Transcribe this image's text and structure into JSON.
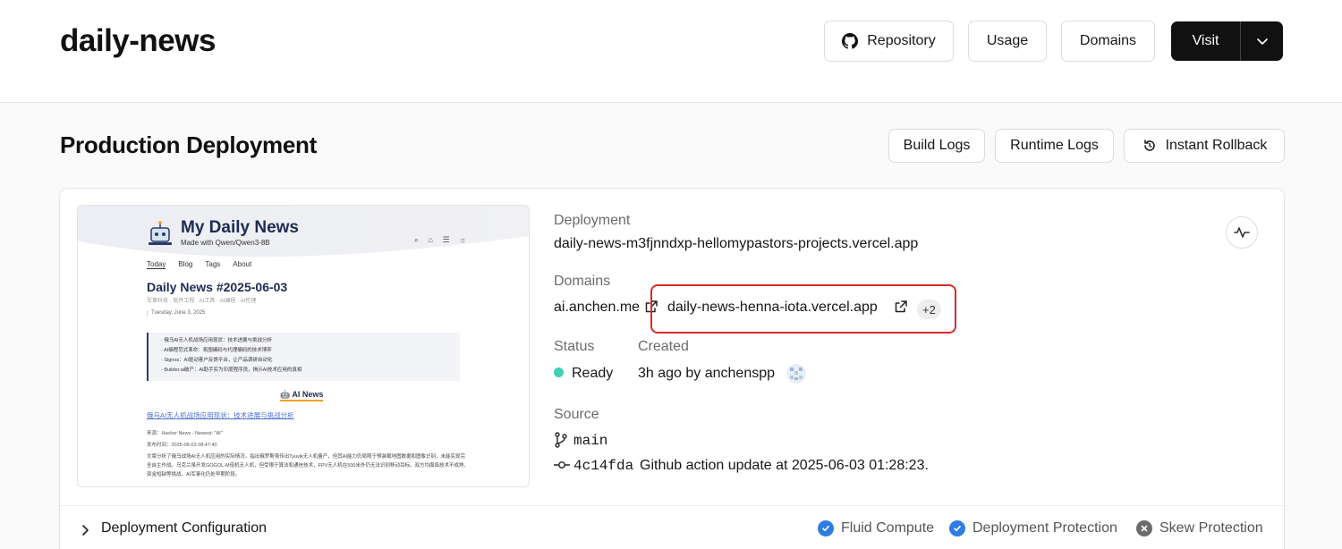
{
  "header": {
    "title": "daily-news",
    "repository_label": "Repository",
    "usage_label": "Usage",
    "domains_label": "Domains",
    "visit_label": "Visit"
  },
  "section": {
    "title": "Production Deployment",
    "build_logs_label": "Build Logs",
    "runtime_logs_label": "Runtime Logs",
    "rollback_label": "Instant Rollback"
  },
  "preview": {
    "site_title": "My Daily News",
    "site_subtitle": "Made with Qwen/Qwen3-8B",
    "nav": [
      "Today",
      "Blog",
      "Tags",
      "About"
    ],
    "post_title": "Daily News #2025-06-03",
    "post_tags": "军事科技 · 软件工程 · AI工具 · AI编程 · AI伦理",
    "post_date": "Tuesday, June 3, 2025",
    "summary_items": [
      "· 俄乌AI无人机战场应用现状：技术进展与挑战分析",
      "· AI编程范式革命：氛围编码与代理编码的技术博弈",
      "· Signos：AI驱动客户反馈平台，让产品调研自动化",
      "· Builder.ai破产：AI助手实为印度程序员，揭示AI技术应用的真相"
    ],
    "section_heading": "🤖 AI News",
    "article_link": "俄乌AI无人机战场应用现状：技术进展与挑战分析",
    "article_source": "来源：Hacker News - Newest: \"AI\"",
    "article_time": "发布时间：2025-06-03 08:47:40",
    "article_body": "文章分析了俄乌战场AI无人机应用的实际情况，指出俄罗斯虽传出Tyuvik无人机量产，但其AI能力仍局限于预装载地图数据和图像识别，未能实现完全自主作战。乌克兰虽开发GOGOL-M母机无人机，但受限于算法和通信技术，FPV无人机在500米外仍无法识别移动目标。双方均面临技术不成熟、资金短缺等挑战，AI军事化仍处早期阶段。"
  },
  "deployment": {
    "label": "Deployment",
    "url": "daily-news-m3fjnndxp-hellomypastors-projects.vercel.app"
  },
  "domains": {
    "label": "Domains",
    "primary": "ai.anchen.me",
    "secondary": "daily-news-henna-iota.vercel.app",
    "more_count": "+2"
  },
  "status": {
    "label": "Status",
    "value": "Ready",
    "color": "#3fd1b2"
  },
  "created": {
    "label": "Created",
    "value": "3h ago by anchenspp"
  },
  "source": {
    "label": "Source",
    "branch": "main",
    "commit_hash": "4c14fda",
    "commit_message": "Github action update at 2025-06-03 01:28:23."
  },
  "config": {
    "label": "Deployment Configuration",
    "features": [
      {
        "label": "Fluid Compute",
        "state": "enabled"
      },
      {
        "label": "Deployment Protection",
        "state": "enabled"
      },
      {
        "label": "Skew Protection",
        "state": "disabled"
      }
    ]
  },
  "colors": {
    "accent_blue": "#2f7de1",
    "highlight_red": "#d92b2b"
  }
}
